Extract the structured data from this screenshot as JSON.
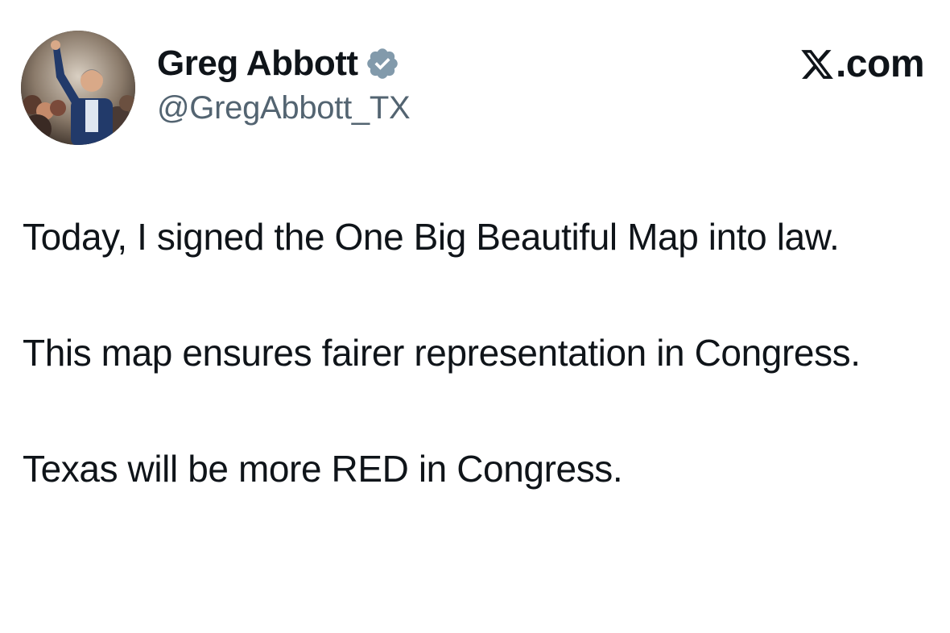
{
  "author": {
    "display_name": "Greg Abbott",
    "handle": "@GregAbbott_TX",
    "verified_icon": "verified-badge-icon",
    "avatar_icon": "profile-photo"
  },
  "brand": {
    "label": ".com",
    "icon": "x-logo-icon"
  },
  "tweet": {
    "paragraphs": [
      "Today, I signed the One Big Beautiful Map into law.",
      "This map ensures fairer representation in Congress.",
      "Texas will be more RED in Congress."
    ]
  },
  "colors": {
    "text_primary": "#0f1419",
    "text_secondary": "#536471",
    "verified_badge": "#829aab"
  }
}
